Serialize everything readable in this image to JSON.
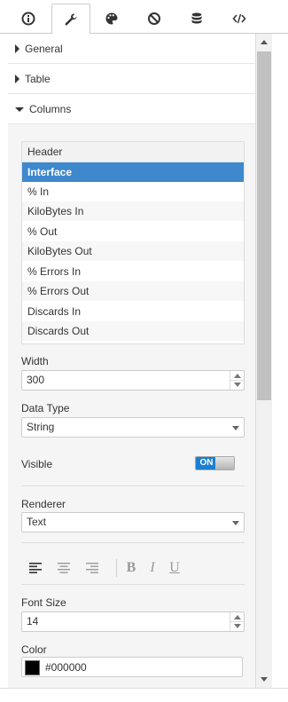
{
  "tabs": [
    {
      "name": "info",
      "icon": "info-icon",
      "active": false
    },
    {
      "name": "settings",
      "icon": "wrench-icon",
      "active": true
    },
    {
      "name": "style",
      "icon": "palette-icon",
      "active": false
    },
    {
      "name": "rules",
      "icon": "ban-icon",
      "active": false
    },
    {
      "name": "data",
      "icon": "database-icon",
      "active": false
    },
    {
      "name": "code",
      "icon": "code-icon",
      "active": false
    }
  ],
  "sections": {
    "general": "General",
    "table": "Table",
    "columns": "Columns"
  },
  "columns_list": {
    "header": "Header",
    "items": [
      "Interface",
      "% In",
      "KiloBytes In",
      "% Out",
      "KiloBytes Out",
      "% Errors In",
      "% Errors Out",
      "Discards In",
      "Discards Out"
    ],
    "selected": "Interface"
  },
  "width": {
    "label": "Width",
    "value": "300"
  },
  "data_type": {
    "label": "Data Type",
    "value": "String"
  },
  "visible": {
    "label": "Visible",
    "state": "ON"
  },
  "renderer": {
    "label": "Renderer",
    "value": "Text"
  },
  "formatting": {
    "align_icons": [
      "align-left-icon",
      "align-center-icon",
      "align-right-icon"
    ],
    "bold": "B",
    "italic": "I",
    "underline": "U"
  },
  "font_size": {
    "label": "Font Size",
    "value": "14"
  },
  "color": {
    "label": "Color",
    "value": "#000000",
    "swatch": "#000000"
  },
  "accent": {
    "selected_row": "#3e88cd",
    "toggle_on": "#1a7fd1"
  }
}
